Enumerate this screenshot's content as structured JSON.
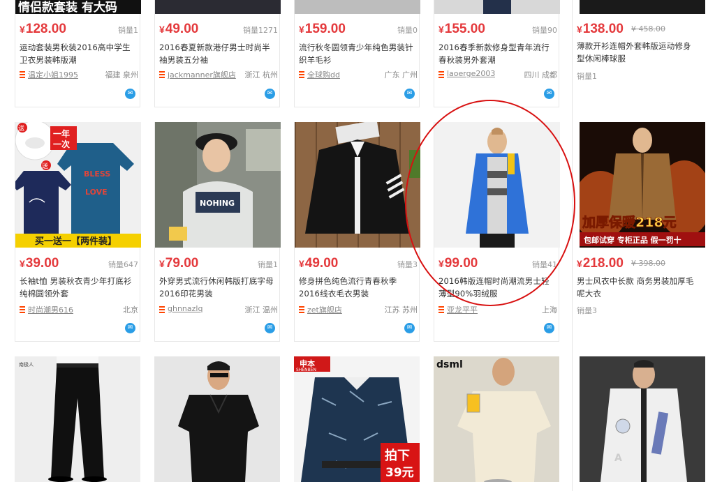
{
  "row1": [
    {
      "banner": "情侣款套装 有大码",
      "price": "128.00",
      "sales": "销量1",
      "title": "运动套装男秋装2016高中学生卫衣男装韩版潮",
      "shop": "温定小姐1995",
      "location": "福建 泉州"
    },
    {
      "price": "49.00",
      "sales": "销量1271",
      "title": "2016春夏新款港仔男士时尚半袖男装五分袖",
      "shop": "jackmanner旗舰店",
      "location": "浙江 杭州"
    },
    {
      "price": "159.00",
      "sales": "销量0",
      "title": "流行秋冬圆领青少年纯色男装针织羊毛衫",
      "shop": "全球购dd",
      "location": "广东 广州"
    },
    {
      "price": "155.00",
      "sales": "销量90",
      "title": "2016春季新款修身型青年流行春秋装男外套潮",
      "shop": "laoerge2003",
      "location": "四川 成都"
    },
    {
      "price": "138.00",
      "original_price": "458.00",
      "sales": "销量1",
      "title": "薄款开衫连帽外套韩版运动修身型休闲棒球服"
    }
  ],
  "row2": [
    {
      "badge_top": "一年一次",
      "badge_left": "送",
      "image_text": [
        "BLESS",
        "LOVE"
      ],
      "banner": "买一送一【两件装】",
      "price": "39.00",
      "sales": "销量647",
      "title": "长袖t恤 男装秋衣青少年打底衫纯棉圆领外套",
      "shop": "时尚潮男616",
      "location": "北京"
    },
    {
      "image_text": "NOHING",
      "price": "79.00",
      "sales": "销量1",
      "title": "外穿男式流行休闲韩版打底字母2016印花男装",
      "shop": "ghnnazlq",
      "location": "浙江 温州"
    },
    {
      "price": "49.00",
      "sales": "销量3",
      "title": "修身拼色纯色流行青春秋季2016线衣毛衣男装",
      "shop": "zet旗舰店",
      "location": "江苏 苏州"
    },
    {
      "price": "99.00",
      "sales": "销量41",
      "title": "2016韩版连帽时尚潮流男士轻薄型90%羽绒服",
      "shop": "亚龙平平",
      "location": "上海"
    },
    {
      "banner_main": "加厚保暖218元",
      "banner_sub": "包邮试穿 专柜正品 假一罚十",
      "price": "218.00",
      "original_price": "398.00",
      "sales": "销量3",
      "title": "男士风衣中长款 商务男装加厚毛呢大衣"
    }
  ],
  "row3": [
    {
      "brand": "南极人"
    },
    {},
    {
      "brand": "申本",
      "brand_en": "SHENBEN",
      "tag_line1": "拍下",
      "tag_line2": "39元"
    },
    {
      "brand": "dsml"
    },
    {}
  ],
  "icons": {
    "wangwang": "chat-bubble-icon",
    "currency": "¥"
  },
  "colors": {
    "price": "#e4393c",
    "highlight_circle": "#d81010",
    "wangwang": "#2a9de6"
  }
}
